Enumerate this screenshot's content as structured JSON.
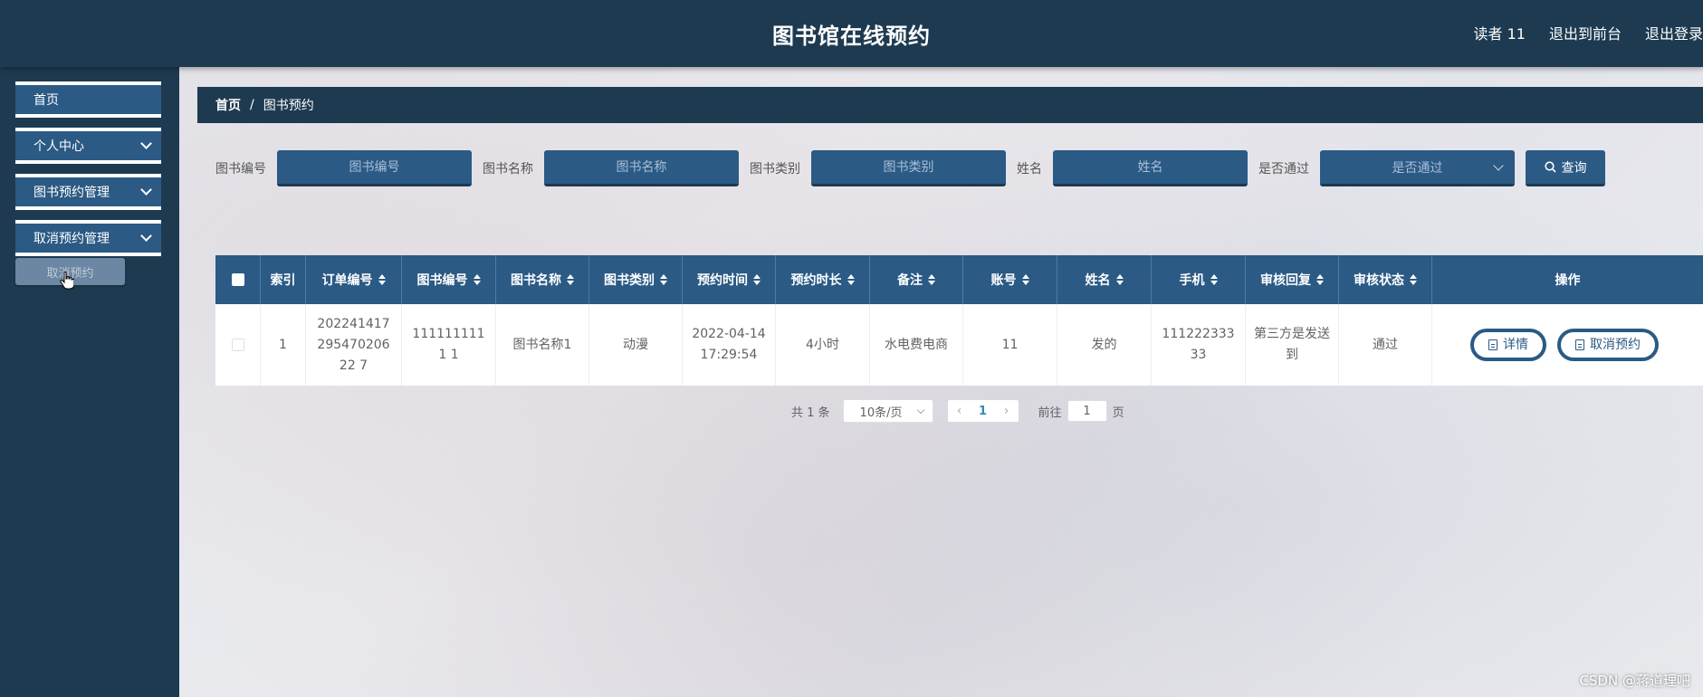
{
  "header": {
    "title": "图书馆在线预约",
    "user_label": "读者 11",
    "front_link": "退出到前台",
    "logout_link": "退出登录"
  },
  "sidebar": {
    "items": [
      {
        "label": "首页"
      },
      {
        "label": "个人中心"
      },
      {
        "label": "图书预约管理"
      },
      {
        "label": "取消预约管理"
      }
    ],
    "submenu_label": "取消预约"
  },
  "breadcrumb": {
    "home": "首页",
    "separator": "/",
    "current": "图书预约"
  },
  "search": {
    "book_no_label": "图书编号",
    "book_no_placeholder": "图书编号",
    "book_name_label": "图书名称",
    "book_name_placeholder": "图书名称",
    "book_type_label": "图书类别",
    "book_type_placeholder": "图书类别",
    "name_label": "姓名",
    "name_placeholder": "姓名",
    "approved_label": "是否通过",
    "approved_placeholder": "是否通过",
    "button_label": "查询"
  },
  "table": {
    "columns": [
      "索引",
      "订单编号",
      "图书编号",
      "图书名称",
      "图书类别",
      "预约时间",
      "预约时长",
      "备注",
      "账号",
      "姓名",
      "手机",
      "审核回复",
      "审核状态",
      "操作"
    ],
    "rows": [
      {
        "index": "1",
        "order_no": "20224141729547020622 7",
        "book_no": "1111111111 1",
        "book_name": "图书名称1",
        "book_type": "动漫",
        "time": "2022-04-14 17:29:54",
        "duration": "4小时",
        "remark": "水电费电商",
        "account": "11",
        "name": "发的",
        "phone": "11122233333",
        "reply": "第三方是发送到",
        "status": "通过",
        "detail_label": "详情",
        "cancel_label": "取消预约"
      }
    ]
  },
  "pagination": {
    "total": "共 1 条",
    "page_size": "10条/页",
    "prev": "‹",
    "current_page": "1",
    "next": "›",
    "goto_label": "前往",
    "goto_value": "1",
    "page_unit": "页"
  },
  "watermark": "CSDN @蒋道理吧"
}
